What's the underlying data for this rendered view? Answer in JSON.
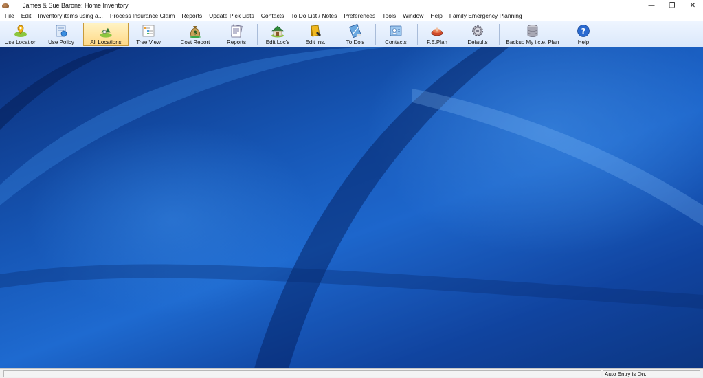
{
  "window": {
    "title": "James & Sue Barone: Home Inventory",
    "controls": {
      "minimize": "—",
      "restore": "❐",
      "close": "✕"
    }
  },
  "menu": [
    "File",
    "Edit",
    "Inventory items using a...",
    "Process Insurance Claim",
    "Reports",
    "Update Pick Lists",
    "Contacts",
    "To Do List / Notes",
    "Preferences",
    "Tools",
    "Window",
    "Help",
    "Family Emergency Planning"
  ],
  "toolbar": [
    {
      "label": "Use Location",
      "icon": "location-icon"
    },
    {
      "label": "Use Policy",
      "icon": "policy-icon"
    },
    {
      "label": "All Locations",
      "icon": "all-locations-icon",
      "active": true
    },
    {
      "label": "Tree View",
      "icon": "tree-view-icon"
    },
    {
      "label": "Cost Report",
      "icon": "money-bag-icon"
    },
    {
      "label": "Reports",
      "icon": "reports-icon"
    },
    {
      "label": "Edit Loc's",
      "icon": "house-icon"
    },
    {
      "label": "Edit Ins.",
      "icon": "book-icon"
    },
    {
      "label": "To Do's",
      "icon": "todo-icon"
    },
    {
      "label": "Contacts",
      "icon": "contacts-icon"
    },
    {
      "label": "F.E.Plan",
      "icon": "emergency-plan-icon"
    },
    {
      "label": "Defaults",
      "icon": "gear-icon"
    },
    {
      "label": "Backup My i.c.e. Plan",
      "icon": "database-icon"
    },
    {
      "label": "Help",
      "icon": "help-icon"
    }
  ],
  "statusbar": {
    "left": "",
    "right": "Auto Entry is On."
  }
}
